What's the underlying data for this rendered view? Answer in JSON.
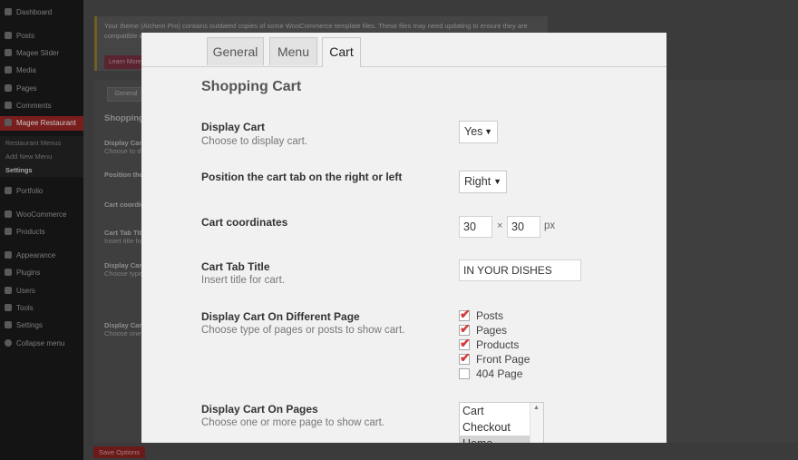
{
  "wp_sidebar": {
    "items": [
      {
        "label": "Dashboard"
      },
      {
        "label": "Posts"
      },
      {
        "label": "Magee Slider"
      },
      {
        "label": "Media"
      },
      {
        "label": "Pages"
      },
      {
        "label": "Comments"
      },
      {
        "label": "Magee Restaurant"
      },
      {
        "label": "Portfolio"
      },
      {
        "label": "WooCommerce"
      },
      {
        "label": "Products"
      },
      {
        "label": "Appearance"
      },
      {
        "label": "Plugins"
      },
      {
        "label": "Users"
      },
      {
        "label": "Tools"
      },
      {
        "label": "Settings"
      },
      {
        "label": "Collapse menu"
      }
    ],
    "submenu": [
      {
        "label": "Restaurant Menus"
      },
      {
        "label": "Add New Menu"
      },
      {
        "label": "Settings"
      }
    ]
  },
  "bg": {
    "notice_text": "Your theme (Alchem Pro) contains outdated copies of some WooCommerce template files. These files may need updating to ensure they are compatible with the current version of WooCommerce. You can see which files are affected from the",
    "notice_button": "Learn More",
    "tab": "General",
    "heading": "Shopping C",
    "labels": [
      {
        "title": "Display Cart",
        "desc": "Choose to display"
      },
      {
        "title": "Position the ca",
        "desc": ""
      },
      {
        "title": "Cart coordinate",
        "desc": ""
      },
      {
        "title": "Cart Tab Title",
        "desc": "Insert title for ca"
      },
      {
        "title": "Display Cart On",
        "desc": "Choose type of pa"
      },
      {
        "title": "Display Cart On",
        "desc": "Choose one or m"
      }
    ],
    "save_button": "Save Options"
  },
  "modal": {
    "tabs": [
      {
        "label": "General"
      },
      {
        "label": "Menu"
      },
      {
        "label": "Cart"
      }
    ],
    "active_tab": "Cart",
    "section_title": "Shopping Cart",
    "display_cart": {
      "label": "Display Cart",
      "desc": "Choose to display cart.",
      "value": "Yes"
    },
    "position": {
      "label": "Position the cart tab on the right or left",
      "value": "Right"
    },
    "coordinates": {
      "label": "Cart coordinates",
      "x": "30",
      "y": "30",
      "separator": "×",
      "unit": "px"
    },
    "tab_title": {
      "label": "Cart Tab Title",
      "desc": "Insert title for cart.",
      "value": "IN YOUR DISHES"
    },
    "display_on_types": {
      "label": "Display Cart On Different Page",
      "desc": "Choose type of pages or posts to show cart.",
      "options": [
        {
          "label": "Posts",
          "checked": true
        },
        {
          "label": "Pages",
          "checked": true
        },
        {
          "label": "Products",
          "checked": true
        },
        {
          "label": "Front Page",
          "checked": true
        },
        {
          "label": "404 Page",
          "checked": false
        }
      ]
    },
    "display_on_pages": {
      "label": "Display Cart On Pages",
      "desc": "Choose one or more page to show cart.",
      "options": [
        {
          "label": "Cart",
          "selected": false
        },
        {
          "label": "Checkout",
          "selected": false
        },
        {
          "label": "Home",
          "selected": true
        }
      ]
    }
  },
  "colors": {
    "accent_red": "#d13a3a",
    "modal_bg": "#f1f1f1"
  }
}
